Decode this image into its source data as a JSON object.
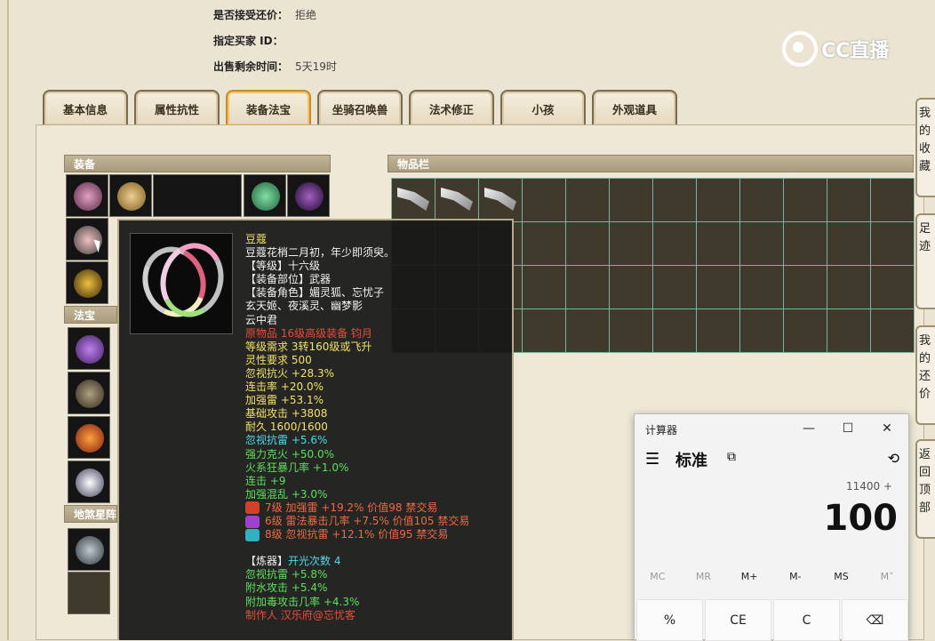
{
  "trade_info": {
    "bargain_label": "是否接受还价：",
    "bargain_value": "拒绝",
    "buyer_label": "指定买家 ID：",
    "remaining_label": "出售剩余时间：",
    "remaining_value": "5天19时"
  },
  "logo": {
    "text": "CC直播"
  },
  "tabs": [
    {
      "label": "基本信息"
    },
    {
      "label": "属性抗性"
    },
    {
      "label": "装备法宝",
      "active": true
    },
    {
      "label": "坐骑召唤兽"
    },
    {
      "label": "法术修正"
    },
    {
      "label": "小孩"
    },
    {
      "label": "外观道具"
    }
  ],
  "sections": {
    "equipment": "装备",
    "treasure": "法宝",
    "star": "地煞星阵",
    "inventory": "物品栏"
  },
  "tooltip": {
    "name": "豆蔻",
    "lines": [
      {
        "text": "豆蔻花梢二月初，年少即须臾。",
        "color": "white"
      },
      {
        "text": "【等级】十六级",
        "color": "white"
      },
      {
        "text": "【装备部位】武器",
        "color": "white"
      },
      {
        "text": "【装备角色】媚灵狐、忘忧子",
        "color": "white"
      },
      {
        "text": "玄天姬、夜溪灵、幽梦影",
        "color": "white"
      },
      {
        "text": "云中君",
        "color": "white"
      },
      {
        "text": "原物品 16级高级装备 钧月",
        "color": "red"
      },
      {
        "text": "等级需求 3转160级或飞升",
        "color": "yellow"
      },
      {
        "text": "灵性要求 500",
        "color": "yellow"
      },
      {
        "text": "忽视抗火 +28.3%",
        "color": "yellow"
      },
      {
        "text": "连击率 +20.0%",
        "color": "yellow"
      },
      {
        "text": "加强雷 +53.1%",
        "color": "yellow"
      },
      {
        "text": "基础攻击 +3808",
        "color": "yellow"
      },
      {
        "text": "耐久 1600/1600",
        "color": "yellow"
      },
      {
        "text": "忽视抗雷 +5.6%",
        "color": "cyan"
      },
      {
        "text": "强力克火 +50.0%",
        "color": "green"
      },
      {
        "text": "火系狂暴几率 +1.0%",
        "color": "green"
      },
      {
        "text": "连击 +9",
        "color": "green"
      },
      {
        "text": "加强混乱 +3.0%",
        "color": "green"
      }
    ],
    "gems": [
      {
        "text": "7级 加强雷 +19.2% 价值98 禁交易",
        "icon_color": "#d0402a"
      },
      {
        "text": "6级 雷法暴击几率 +7.5% 价值105 禁交易",
        "icon_color": "#a040d0"
      },
      {
        "text": "8级 忽视抗雷 +12.1% 价值95 禁交易",
        "icon_color": "#30b0c0"
      }
    ],
    "refine_label": "【炼器】",
    "refine_value": "开光次数 4",
    "refine_lines": [
      {
        "text": "忽视抗雷 +5.8%",
        "color": "green"
      },
      {
        "text": "附水攻击 +5.4%",
        "color": "green"
      },
      {
        "text": "附加毒攻击几率 +4.3%",
        "color": "green"
      }
    ],
    "maker": "制作人 汉乐府@忘忧客"
  },
  "calculator": {
    "title": "计算器",
    "minimize": "—",
    "maximize": "☐",
    "close": "✕",
    "menu_icon": "☰",
    "mode": "标准",
    "keep_icon": "⧉",
    "history_icon": "⟲",
    "expression": "11400 +",
    "display": "100",
    "memory": [
      "MC",
      "MR",
      "M+",
      "M-",
      "MS",
      "M˅"
    ],
    "memory_enabled": [
      false,
      false,
      true,
      true,
      true,
      false
    ],
    "keys": [
      "%",
      "CE",
      "C",
      "⌫"
    ]
  },
  "side_tabs": [
    {
      "text": "我的收藏"
    },
    {
      "text": "足迹"
    },
    {
      "text": "我的还价"
    },
    {
      "text": "返回顶部"
    }
  ]
}
